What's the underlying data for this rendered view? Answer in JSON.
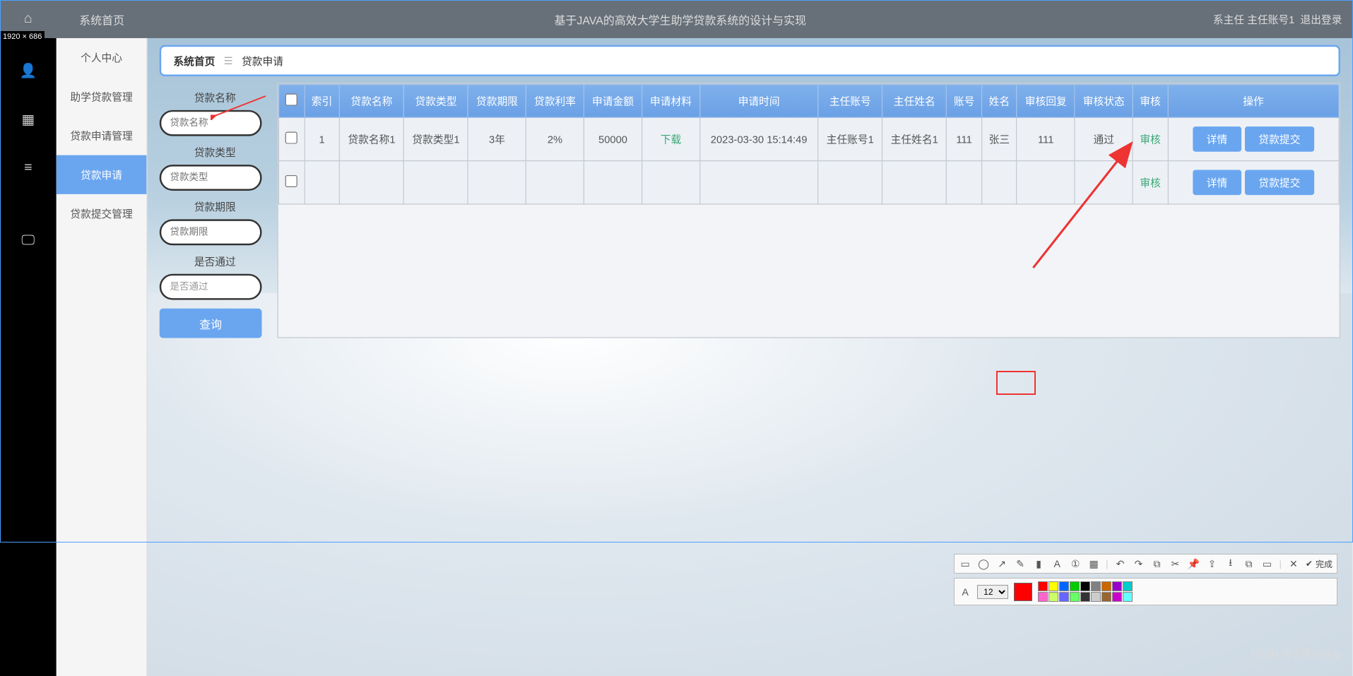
{
  "topbar": {
    "sys_home": "系统首页",
    "app_title": "基于JAVA的高效大学生助学贷款系统的设计与实现",
    "role": "系主任",
    "user": "主任账号1",
    "logout": "退出登录"
  },
  "dims_badge": "1920 × 686",
  "sidebar": {
    "items": [
      {
        "label": "个人中心"
      },
      {
        "label": "助学贷款管理"
      },
      {
        "label": "贷款申请管理"
      },
      {
        "label": "贷款申请",
        "current": true
      },
      {
        "label": "贷款提交管理"
      }
    ]
  },
  "breadcrumb": {
    "home": "系统首页",
    "current": "贷款申请"
  },
  "filters": {
    "f1_label": "贷款名称",
    "f1_ph": "贷款名称",
    "f2_label": "贷款类型",
    "f2_ph": "贷款类型",
    "f3_label": "贷款期限",
    "f3_ph": "贷款期限",
    "f4_label": "是否通过",
    "f4_ph": "是否通过",
    "query": "查询"
  },
  "table": {
    "headers": [
      "",
      "索引",
      "贷款名称",
      "贷款类型",
      "贷款期限",
      "贷款利率",
      "申请金额",
      "申请材料",
      "申请时间",
      "主任账号",
      "主任姓名",
      "账号",
      "姓名",
      "审核回复",
      "审核状态",
      "审核",
      "操作"
    ],
    "rows": [
      {
        "idx": "1",
        "name": "贷款名称1",
        "type": "贷款类型1",
        "term": "3年",
        "rate": "2%",
        "amount": "50000",
        "material": "下载",
        "time": "2023-03-30 15:14:49",
        "dacc": "主任账号1",
        "dname": "主任姓名1",
        "acc": "111",
        "uname": "张三",
        "reply": "111",
        "status": "通过",
        "audit": "审核"
      },
      {
        "idx": "",
        "name": "",
        "type": "",
        "term": "",
        "rate": "",
        "amount": "",
        "material": "",
        "time": "",
        "dacc": "",
        "dname": "",
        "acc": "",
        "uname": "",
        "reply": "",
        "status": "",
        "audit": "审核"
      }
    ],
    "op_detail": "详情",
    "op_submit": "贷款提交"
  },
  "toolbox": {
    "font_size": "12",
    "done": "完成",
    "palette": [
      "#ff0000",
      "#ffff00",
      "#0066ff",
      "#00cc00",
      "#000000",
      "#808080",
      "#cc6600",
      "#9900cc",
      "#00cccc",
      "#ff66cc",
      "#ccff66",
      "#6666ff",
      "#66ff66",
      "#333333",
      "#cccccc",
      "#996633",
      "#cc00cc",
      "#66ffff"
    ]
  },
  "watermark": "CSDN @小蔡coding"
}
